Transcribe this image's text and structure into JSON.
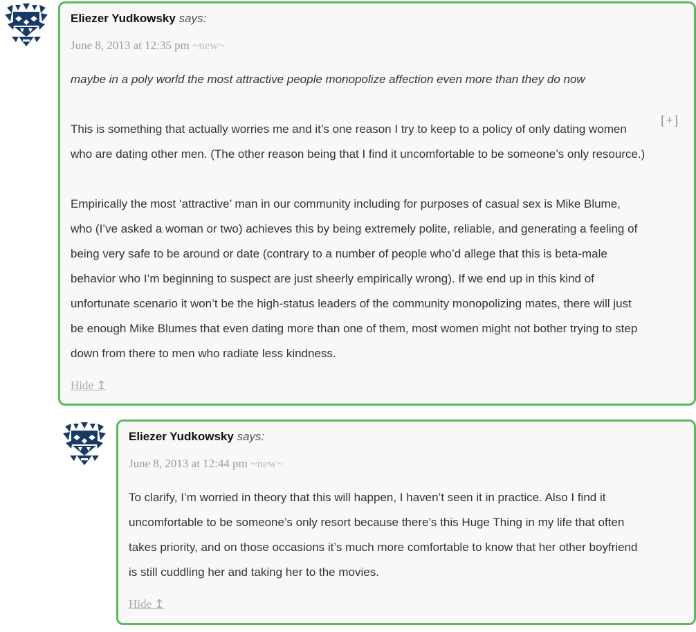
{
  "comments": [
    {
      "author": "Eliezer Yudkowsky",
      "says": "says:",
      "date": "June 8, 2013 at 12:35 pm",
      "new_tag": "~new~",
      "avatar_icon": "identicon-avatar-icon",
      "quote": "maybe in a poly world the most attractive people monopolize affection even more than they do now",
      "paragraph1_line1": "This is something that actually worries me and it’s one reason I try to keep to a policy of only dating women",
      "paragraph1_line2": "who are dating other men. (The other reason being that I find it uncomfortable to be someone’s only resource.)",
      "paragraph2_lines": [
        "Empirically the most ‘attractive’ man in our community including for purposes of casual sex is Mike Blume,",
        "who (I’ve asked a woman or two) achieves this by being extremely polite, reliable, and generating a feeling of",
        "being very safe to be around or date (contrary to a number of people who’d allege that this is beta-male",
        "behavior who I’m beginning to suspect are just sheerly empirically wrong). If we end up in this kind of",
        "unfortunate scenario it won’t be the high-status leaders of the community monopolizing mates, there will just",
        "be enough Mike Blumes that even dating more than one of them, most women might not bother trying to step",
        "down from there to men who radiate less kindness."
      ],
      "hide_label": "Hide ↥",
      "expand_label": "[+]"
    },
    {
      "author": "Eliezer Yudkowsky",
      "says": "says:",
      "date": "June 8, 2013 at 12:44 pm",
      "new_tag": "~new~",
      "avatar_icon": "identicon-avatar-icon",
      "body_lines": [
        "To clarify, I’m worried in theory that this will happen, I haven’t seen it in practice. Also I find it",
        "uncomfortable to be someone’s only resort because there’s this Huge Thing in my life that often",
        "takes priority, and on those occasions it’s much more comfortable to know that her other boyfriend",
        "is still cuddling her and taking her to the movies."
      ],
      "hide_label": "Hide ↥"
    }
  ],
  "colors": {
    "border": "#5cb85c",
    "avatar": "#1a3a66",
    "background": "#f8f8f8"
  }
}
